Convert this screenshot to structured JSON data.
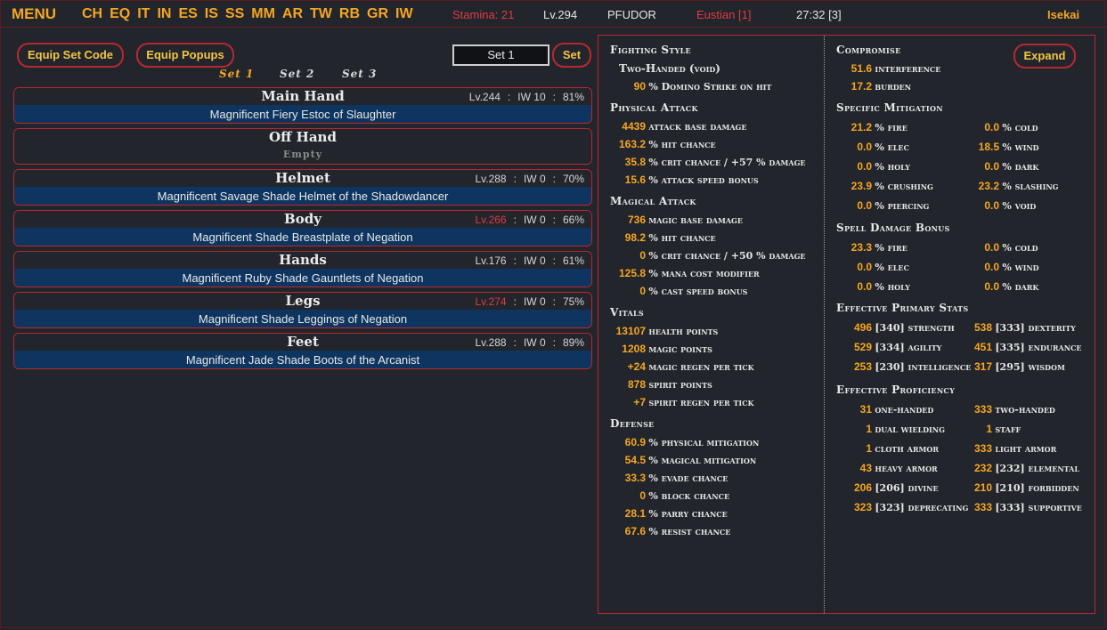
{
  "topbar": {
    "menu": "MENU",
    "nav": [
      "CH",
      "EQ",
      "IT",
      "IN",
      "ES",
      "IS",
      "SS",
      "MM",
      "AR",
      "TW",
      "RB",
      "GR",
      "IW"
    ],
    "stamina": "Stamina: 21",
    "level": "Lv.294",
    "player": "PFUDOR",
    "eustian": "Eustian [1]",
    "time": "27:32 [3]",
    "world": "Isekai"
  },
  "toolbar": {
    "equip_set_code": "Equip Set Code",
    "equip_popups": "Equip Popups",
    "set_name_value": "Set 1",
    "set_button": "Set"
  },
  "set_tabs": [
    "Set 1",
    "Set 2",
    "Set 3"
  ],
  "slots": [
    {
      "name": "Main Hand",
      "level": "Lv.244",
      "level_red": false,
      "iw": "IW 10",
      "cond": "81%",
      "item": "Magnificent Fiery Estoc of Slaughter"
    },
    {
      "name": "Off Hand",
      "level": "",
      "level_red": false,
      "iw": "",
      "cond": "",
      "item": "Empty"
    },
    {
      "name": "Helmet",
      "level": "Lv.288",
      "level_red": false,
      "iw": "IW 0",
      "cond": "70%",
      "item": "Magnificent Savage Shade Helmet of the Shadowdancer"
    },
    {
      "name": "Body",
      "level": "Lv.266",
      "level_red": true,
      "iw": "IW 0",
      "cond": "66%",
      "item": "Magnificent Shade Breastplate of Negation"
    },
    {
      "name": "Hands",
      "level": "Lv.176",
      "level_red": false,
      "iw": "IW 0",
      "cond": "61%",
      "item": "Magnificent Ruby Shade Gauntlets of Negation"
    },
    {
      "name": "Legs",
      "level": "Lv.274",
      "level_red": true,
      "iw": "IW 0",
      "cond": "75%",
      "item": "Magnificent Shade Leggings of Negation"
    },
    {
      "name": "Feet",
      "level": "Lv.288",
      "level_red": false,
      "iw": "IW 0",
      "cond": "89%",
      "item": "Magnificent Jade Shade Boots of the Arcanist"
    }
  ],
  "left_stats": {
    "fighting_style": {
      "title": "Fighting Style",
      "style": "Two-Handed (void)",
      "v": "90",
      "l": "% Domino Strike on hit"
    },
    "physical_attack": {
      "title": "Physical Attack",
      "rows": [
        {
          "v": "4439",
          "l": "attack base damage"
        },
        {
          "v": "163.2",
          "l": "% hit chance"
        },
        {
          "v": "35.8",
          "l": "% crit chance / +57 % damage"
        },
        {
          "v": "15.6",
          "l": "% attack speed bonus"
        }
      ]
    },
    "magical_attack": {
      "title": "Magical Attack",
      "rows": [
        {
          "v": "736",
          "l": "magic base damage"
        },
        {
          "v": "98.2",
          "l": "% hit chance"
        },
        {
          "v": "0",
          "l": "% crit chance / +50 % damage"
        },
        {
          "v": "125.8",
          "l": "% mana cost modifier"
        },
        {
          "v": "0",
          "l": "% cast speed bonus"
        }
      ]
    },
    "vitals": {
      "title": "Vitals",
      "rows": [
        {
          "v": "13107",
          "l": "health points"
        },
        {
          "v": "1208",
          "l": "magic points"
        },
        {
          "v": "+24",
          "l": "magic regen per tick"
        },
        {
          "v": "878",
          "l": "spirit points"
        },
        {
          "v": "+7",
          "l": "spirit regen per tick"
        }
      ]
    },
    "defense": {
      "title": "Defense",
      "rows": [
        {
          "v": "60.9",
          "l": "% physical mitigation"
        },
        {
          "v": "54.5",
          "l": "% magical mitigation"
        },
        {
          "v": "33.3",
          "l": "% evade chance"
        },
        {
          "v": "0",
          "l": "% block chance"
        },
        {
          "v": "28.1",
          "l": "% parry chance"
        },
        {
          "v": "67.6",
          "l": "% resist chance"
        }
      ]
    }
  },
  "right_stats": {
    "compromise": {
      "title": "Compromise",
      "expand": "Expand",
      "rows": [
        {
          "v": "51.6",
          "l": "interference"
        },
        {
          "v": "17.2",
          "l": "burden"
        }
      ]
    },
    "specific_mitigation": {
      "title": "Specific Mitigation",
      "rows": [
        [
          {
            "v": "21.2",
            "l": "% fire"
          },
          {
            "v": "0.0",
            "l": "% cold"
          }
        ],
        [
          {
            "v": "0.0",
            "l": "% elec"
          },
          {
            "v": "18.5",
            "l": "% wind"
          }
        ],
        [
          {
            "v": "0.0",
            "l": "% holy"
          },
          {
            "v": "0.0",
            "l": "% dark"
          }
        ],
        [
          {
            "v": "23.9",
            "l": "% crushing"
          },
          {
            "v": "23.2",
            "l": "% slashing"
          }
        ],
        [
          {
            "v": "0.0",
            "l": "% piercing"
          },
          {
            "v": "0.0",
            "l": "% void"
          }
        ]
      ]
    },
    "spell_damage": {
      "title": "Spell Damage Bonus",
      "rows": [
        [
          {
            "v": "23.3",
            "l": "% fire"
          },
          {
            "v": "0.0",
            "l": "% cold"
          }
        ],
        [
          {
            "v": "0.0",
            "l": "% elec"
          },
          {
            "v": "0.0",
            "l": "% wind"
          }
        ],
        [
          {
            "v": "0.0",
            "l": "% holy"
          },
          {
            "v": "0.0",
            "l": "% dark"
          }
        ]
      ]
    },
    "primary_stats": {
      "title": "Effective Primary Stats",
      "rows": [
        [
          {
            "v": "496",
            "l": "[340] strength"
          },
          {
            "v": "538",
            "l": "[333] dexterity"
          }
        ],
        [
          {
            "v": "529",
            "l": "[334] agility"
          },
          {
            "v": "451",
            "l": "[335] endurance"
          }
        ],
        [
          {
            "v": "253",
            "l": "[230] intelligence"
          },
          {
            "v": "317",
            "l": "[295] wisdom"
          }
        ]
      ]
    },
    "proficiency": {
      "title": "Effective Proficiency",
      "rows": [
        [
          {
            "v": "31",
            "l": "one-handed"
          },
          {
            "v": "333",
            "l": "two-handed"
          }
        ],
        [
          {
            "v": "1",
            "l": "dual wielding"
          },
          {
            "v": "1",
            "l": "staff"
          }
        ],
        [
          {
            "v": "1",
            "l": "cloth armor"
          },
          {
            "v": "333",
            "l": "light armor"
          }
        ],
        [
          {
            "v": "43",
            "l": "heavy armor"
          },
          {
            "v": "232",
            "l": "[232] elemental"
          }
        ],
        [
          {
            "v": "206",
            "l": "[206] divine"
          },
          {
            "v": "210",
            "l": "[210] forbidden"
          }
        ],
        [
          {
            "v": "323",
            "l": "[323] deprecating"
          },
          {
            "v": "333",
            "l": "[333] supportive"
          }
        ]
      ]
    }
  }
}
